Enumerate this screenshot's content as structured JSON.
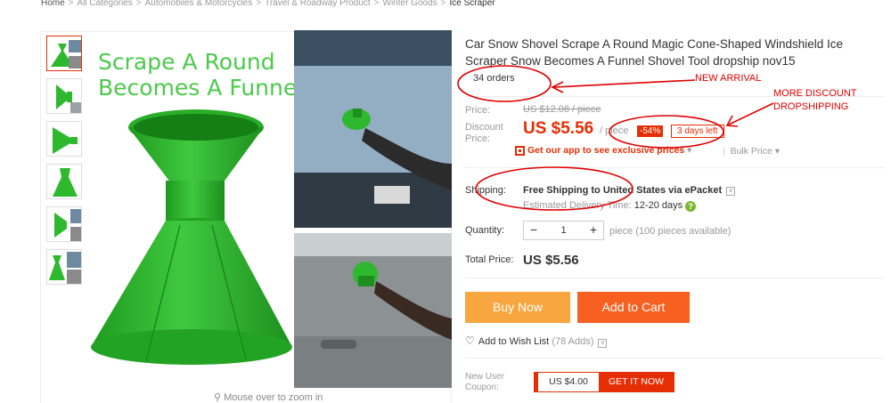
{
  "breadcrumb": [
    "Home",
    "All Categories",
    "Automobiles & Motorcycles",
    "Travel & Roadway Product",
    "Winter Goods",
    "Ice Scraper"
  ],
  "gallery": {
    "caption": "Scrape A Round Becomes A Funnel",
    "zoom_hint": "Mouse over to zoom in",
    "thumbnail_count": 6
  },
  "product": {
    "title": "Car Snow Shovel Scrape A Round Magic Cone-Shaped Windshield Ice Scraper Snow Becomes A Funnel Shovel Tool dropship nov15",
    "orders": "34 orders",
    "price_label": "Price:",
    "original_price": "US $12.08 / piece",
    "discount_price_label": "Discount Price:",
    "discount_price": "US $5.56",
    "price_unit": "/ piece",
    "discount_badge": "-54%",
    "days_left": "3 days left",
    "app_link": "Get our app to see exclusive prices",
    "app_link_caret": "▾",
    "bulk_price": "Bulk Price",
    "bulk_price_caret": "▾"
  },
  "shipping": {
    "label": "Shipping:",
    "value": "Free Shipping to United States via ePacket",
    "caret": "v",
    "delivery_label": "Estimated Delivery Time:",
    "delivery_value": "12-20 days",
    "help": "?"
  },
  "quantity": {
    "label": "Quantity:",
    "minus": "−",
    "plus": "+",
    "value": "1",
    "available": "piece (100 pieces available)"
  },
  "total": {
    "label": "Total Price:",
    "value": "US $5.56"
  },
  "actions": {
    "buy_now": "Buy Now",
    "add_to_cart": "Add to Cart",
    "wishlist": "Add to Wish List",
    "wishlist_adds": "(78 Adds)",
    "wishlist_caret": "v"
  },
  "coupon": {
    "label": "New User Coupon:",
    "amount": "US $4.00",
    "button": "GET IT NOW"
  },
  "annotations": {
    "new_arrival": "NEW ARRIVAL",
    "more_discount_line1": "MORE DISCOUNT",
    "more_discount_line2": "DROPSHIPPING"
  },
  "colors": {
    "accent_red": "#e62e04",
    "buy_now": "#f7a640",
    "add_to_cart": "#f76021",
    "product_green": "#2eb82e",
    "annotation_red": "#e00000"
  }
}
